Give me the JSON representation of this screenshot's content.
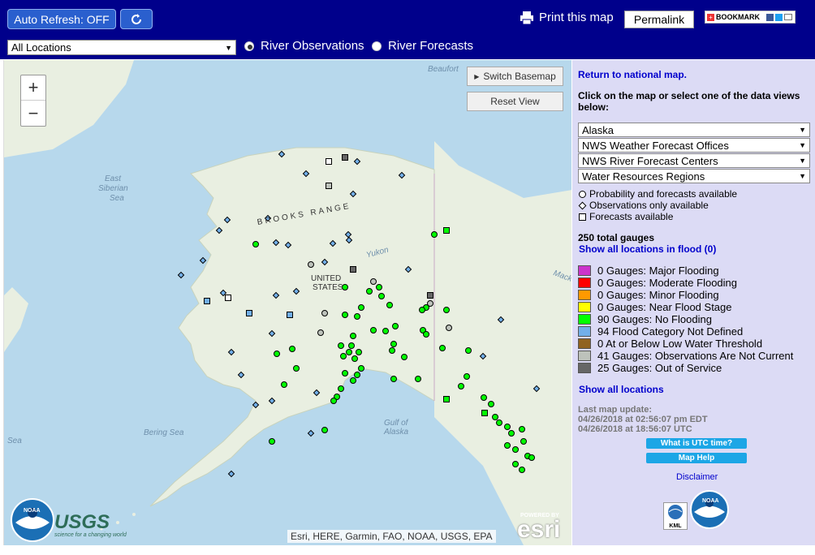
{
  "toolbar": {
    "auto_refresh_label": "Auto Refresh: OFF",
    "print_label": "Print this map",
    "permalink_label": "Permalink",
    "bookmark_label": "BOOKMARK",
    "location_select_value": "All Locations",
    "radio_observations": "River Observations",
    "radio_forecasts": "River Forecasts",
    "selected_radio": "River Observations"
  },
  "map": {
    "switch_basemap_label": "Switch Basemap",
    "reset_view_label": "Reset View",
    "zoom_in": "+",
    "zoom_out": "−",
    "labels": {
      "beaufort": "Beaufort",
      "east_siberian_sea_1": "East",
      "east_siberian_sea_2": "Siberian",
      "east_siberian_sea_3": "Sea",
      "brooks_range": "BROOKS RANGE",
      "yukon": "Yukon",
      "united_states_1": "UNITED",
      "united_states_2": "STATES",
      "bering_sea": "Bering Sea",
      "sea": "Sea",
      "gulf_of_alaska_1": "Gulf of",
      "gulf_of_alaska_2": "Alaska",
      "mackenzie": "Macke"
    },
    "attribution": "Esri, HERE, Garmin, FAO, NOAA, USGS, EPA",
    "esri_powered": "POWERED BY",
    "esri_logo": "esri",
    "noaa_logo_text": "NOAA",
    "usgs_logo_text": "USGS",
    "usgs_tagline": "science for a changing world",
    "land_color": "#e9efe1",
    "water_color": "#b7d8ec"
  },
  "sidebar": {
    "return_link": "Return to national map.",
    "instructions": "Click on the map or select one of the data views below:",
    "selects": [
      "Alaska",
      "NWS Weather Forecast Offices",
      "NWS River Forecast Centers",
      "Water Resources Regions"
    ],
    "shape_legend": [
      {
        "shape": "circle",
        "label": "Probability and forecasts available"
      },
      {
        "shape": "diamond",
        "label": "Observations only available"
      },
      {
        "shape": "square",
        "label": "Forecasts available"
      }
    ],
    "total_gauges": "250 total gauges",
    "show_flood_link": "Show all locations in flood (0)",
    "legend": [
      {
        "color": "#cc33cc",
        "label": "0 Gauges: Major Flooding"
      },
      {
        "color": "#ff0000",
        "label": "0 Gauges: Moderate Flooding"
      },
      {
        "color": "#ff9900",
        "label": "0 Gauges: Minor Flooding"
      },
      {
        "color": "#ffff00",
        "label": "0 Gauges: Near Flood Stage"
      },
      {
        "color": "#00ff00",
        "label": "90 Gauges: No Flooding"
      },
      {
        "color": "#72afe9",
        "label": "94 Flood Category Not Defined"
      },
      {
        "color": "#906320",
        "label": "0 At or Below Low Water Threshold"
      },
      {
        "color": "#bdc2bb",
        "label": "41 Gauges: Observations Are Not Current"
      },
      {
        "color": "#666666",
        "label": "25 Gauges: Out of Service"
      }
    ],
    "show_all_link": "Show all locations",
    "last_update_label": "Last map update:",
    "last_update_edt": "04/26/2018 at 02:56:07 pm EDT",
    "last_update_utc": "04/26/2018 at 18:56:07 UTC",
    "utc_button": "What is UTC time?",
    "help_button": "Map Help",
    "disclaimer": "Disclaimer",
    "kml_label": "KML",
    "noaa_text": "NOAA"
  }
}
